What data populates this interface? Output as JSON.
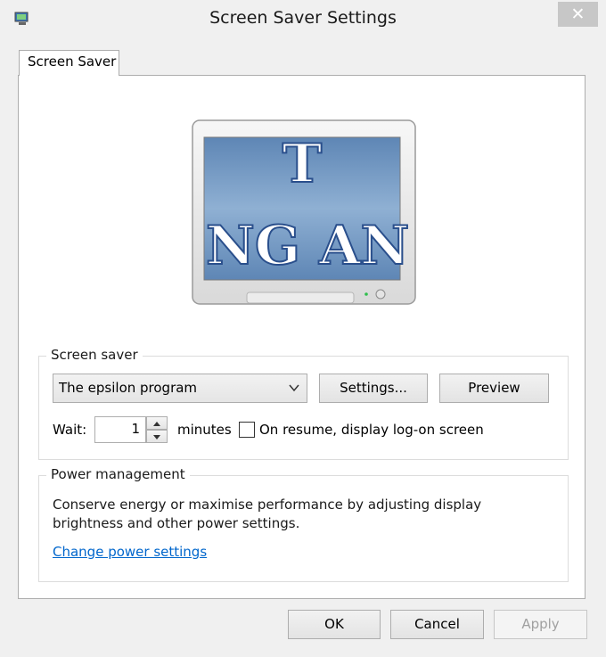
{
  "window": {
    "title": "Screen Saver Settings",
    "close_label": "✕"
  },
  "tabs": [
    {
      "label": "Screen Saver"
    }
  ],
  "preview_monitor": {
    "text_top": "T",
    "text_bottom": "NG AN"
  },
  "screen_saver": {
    "legend": "Screen saver",
    "selected": "The epsilon program",
    "settings_label": "Settings...",
    "preview_label": "Preview",
    "wait_label": "Wait:",
    "wait_value": "1",
    "minutes_label": "minutes",
    "resume_label": "On resume, display log-on screen",
    "resume_checked": false
  },
  "power": {
    "legend": "Power management",
    "description": "Conserve energy or maximise performance by adjusting display brightness and other power settings.",
    "link": "Change power settings"
  },
  "footer": {
    "ok": "OK",
    "cancel": "Cancel",
    "apply": "Apply",
    "apply_enabled": false
  },
  "colors": {
    "link": "#0066cc",
    "close_bg": "#c7c7c7"
  }
}
